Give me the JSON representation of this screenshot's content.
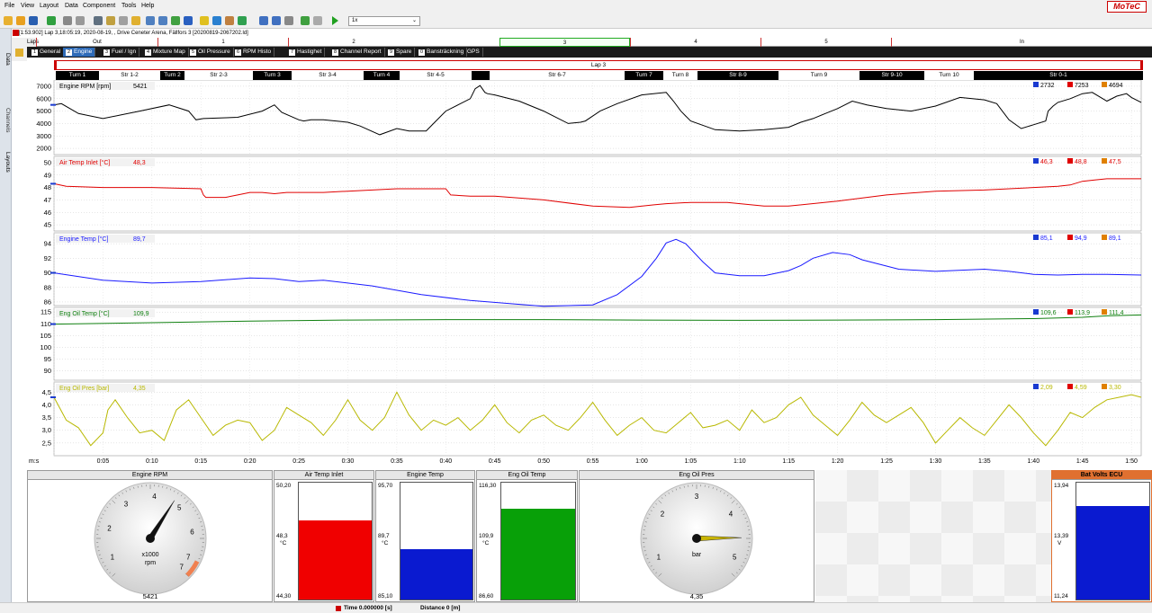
{
  "menu": [
    "File",
    "View",
    "Layout",
    "Data",
    "Component",
    "Tools",
    "Help"
  ],
  "brand": "MoTeC",
  "toolbar": {
    "zoom_value": "1x"
  },
  "dock_tabs": [
    "Data",
    "Channels",
    "Layouts"
  ],
  "file_info": "[1:53.902] Lap 3,18:05:19, 2020-08-19, , Drive Ceneter Arena, Fällfors 3 [20200819-2067202.ld]",
  "laps": {
    "label": "Laps",
    "items": [
      "Out",
      "1",
      "2",
      "3",
      "4",
      "5",
      "In"
    ]
  },
  "worksheet_tabs": [
    {
      "num": "1",
      "label": "General"
    },
    {
      "num": "2",
      "label": "Engine"
    },
    {
      "num": "3",
      "label": "Fuel / Ign"
    },
    {
      "num": "4",
      "label": "Mixture Map"
    },
    {
      "num": "5",
      "label": "Oil Pressure"
    },
    {
      "num": "6",
      "label": "RPM Histo"
    },
    {
      "num": "7",
      "label": "Hastighet"
    },
    {
      "num": "8",
      "label": "Channel Report"
    },
    {
      "num": "9",
      "label": "Spare"
    },
    {
      "num": "0",
      "label": "Bansträckning"
    },
    {
      "num": "",
      "label": "GPS"
    }
  ],
  "lap_band": "Lap 3",
  "sectors": [
    {
      "label": "Turn 1",
      "style": "b"
    },
    {
      "label": "Str 1-2",
      "style": "w"
    },
    {
      "label": "Turn 2",
      "style": "b"
    },
    {
      "label": "Str 2-3",
      "style": "w"
    },
    {
      "label": "Turn 3",
      "style": "b"
    },
    {
      "label": "Str 3-4",
      "style": "w"
    },
    {
      "label": "Turn 4",
      "style": "b"
    },
    {
      "label": "Str 4-5",
      "style": "w"
    },
    {
      "label": "",
      "style": "b"
    },
    {
      "label": "Str 6-7",
      "style": "w"
    },
    {
      "label": "Turn 7",
      "style": "b"
    },
    {
      "label": "Turn 8",
      "style": "w"
    },
    {
      "label": "Str 8-9",
      "style": "b"
    },
    {
      "label": "Turn 9",
      "style": "w"
    },
    {
      "label": "Str 9-10",
      "style": "b"
    },
    {
      "label": "Turn 10",
      "style": "w"
    },
    {
      "label": "Str 0-1",
      "style": "b"
    }
  ],
  "chart_data": [
    {
      "type": "line",
      "title": "Engine RPM [rpm]",
      "current": "5421",
      "color": "#000000",
      "ylim": [
        1500,
        7500
      ],
      "yticks": [
        "7000",
        "6000",
        "5000",
        "4000",
        "3000",
        "2000"
      ],
      "min": "2732",
      "max": "7253",
      "avg": "4694",
      "x": [
        0,
        3,
        10,
        20,
        35,
        47,
        55,
        58,
        61,
        75,
        85,
        90,
        93,
        100,
        102,
        105,
        110,
        120,
        125,
        133,
        140,
        145,
        152,
        155,
        160,
        165,
        170,
        172,
        174,
        176,
        177,
        180,
        190,
        200,
        210,
        215,
        217,
        220,
        223,
        230,
        240,
        250,
        253,
        256,
        258,
        260,
        270,
        280,
        290,
        300,
        305,
        310,
        315,
        320,
        326,
        332,
        340,
        350,
        360,
        370,
        375,
        380,
        385,
        390,
        395,
        400,
        405,
        406,
        408,
        410,
        415,
        420,
        424,
        430,
        434,
        438,
        440,
        444
      ],
      "y": [
        5500,
        5600,
        4800,
        4400,
        5000,
        5500,
        5000,
        4300,
        4400,
        4500,
        5000,
        5500,
        4900,
        4300,
        4200,
        4300,
        4300,
        4100,
        3800,
        3100,
        3600,
        3400,
        3400,
        4000,
        5000,
        5500,
        6000,
        6800,
        7050,
        6500,
        6400,
        6300,
        5800,
        5000,
        4000,
        4100,
        4200,
        4600,
        5000,
        5600,
        6300,
        6500,
        5800,
        5000,
        4600,
        4200,
        3500,
        3400,
        3500,
        3700,
        4100,
        4400,
        4800,
        5200,
        5800,
        5500,
        5200,
        5000,
        5400,
        6100,
        6000,
        5900,
        5600,
        4300,
        3600,
        3900,
        4200,
        5000,
        5400,
        5700,
        6000,
        6400,
        6500,
        5800,
        6200,
        6400,
        6100,
        5700
      ]
    },
    {
      "type": "line",
      "title": "Air Temp Inlet [°C]",
      "current": "48,3",
      "color": "#e00000",
      "ylim": [
        44.5,
        50.5
      ],
      "yticks": [
        "50",
        "49",
        "48",
        "47",
        "46",
        "45"
      ],
      "min": "46,3",
      "max": "48,8",
      "avg": "47,5",
      "x": [
        0,
        5,
        20,
        40,
        60,
        61,
        62,
        70,
        75,
        80,
        85,
        90,
        95,
        100,
        110,
        120,
        140,
        160,
        162,
        170,
        180,
        200,
        220,
        235,
        245,
        250,
        260,
        275,
        290,
        300,
        320,
        340,
        360,
        380,
        400,
        410,
        415,
        420,
        425,
        430,
        444
      ],
      "y": [
        48.3,
        48.1,
        48.0,
        48.0,
        47.9,
        47.4,
        47.2,
        47.2,
        47.4,
        47.6,
        47.6,
        47.5,
        47.6,
        47.6,
        47.6,
        47.7,
        47.9,
        47.9,
        47.4,
        47.3,
        47.3,
        47.0,
        46.5,
        46.4,
        46.6,
        46.7,
        46.8,
        46.8,
        46.5,
        46.5,
        46.9,
        47.4,
        47.7,
        47.8,
        48.0,
        48.1,
        48.2,
        48.5,
        48.6,
        48.7,
        48.7
      ]
    },
    {
      "type": "line",
      "title": "Engine Temp [°C]",
      "current": "89,7",
      "color": "#1a1aff",
      "ylim": [
        85.5,
        95.5
      ],
      "yticks": [
        "94",
        "92",
        "90",
        "88",
        "86"
      ],
      "min": "85,1",
      "max": "94,9",
      "avg": "89,1",
      "x": [
        0,
        20,
        40,
        60,
        80,
        90,
        100,
        110,
        130,
        150,
        170,
        200,
        220,
        230,
        240,
        246,
        250,
        254,
        258,
        265,
        270,
        280,
        290,
        300,
        305,
        310,
        318,
        325,
        330,
        345,
        360,
        380,
        390,
        400,
        410,
        420,
        430,
        444
      ],
      "y": [
        90.0,
        89.0,
        88.6,
        88.8,
        89.3,
        89.2,
        88.8,
        89.0,
        88.2,
        87.0,
        86.2,
        85.4,
        85.6,
        87.0,
        89.5,
        92.0,
        94.1,
        94.6,
        94.0,
        91.5,
        90.0,
        89.6,
        89.6,
        90.3,
        91.0,
        92.0,
        92.8,
        92.5,
        91.8,
        90.5,
        90.2,
        90.5,
        90.2,
        89.8,
        89.7,
        89.8,
        89.8,
        89.7
      ]
    },
    {
      "type": "line",
      "title": "Eng Oil Temp [°C]",
      "current": "109,9",
      "color": "#108010",
      "ylim": [
        86,
        117
      ],
      "yticks": [
        "115",
        "110",
        "105",
        "100",
        "95",
        "90"
      ],
      "min": "109,6",
      "max": "113,9",
      "avg": "111,4",
      "x": [
        0,
        40,
        80,
        120,
        160,
        200,
        240,
        280,
        320,
        360,
        400,
        420,
        430,
        444
      ],
      "y": [
        109.9,
        110.5,
        111.2,
        111.6,
        111.8,
        111.8,
        111.6,
        111.5,
        111.6,
        111.8,
        112.2,
        112.8,
        113.4,
        113.8
      ]
    },
    {
      "type": "line",
      "title": "Eng Oil Pres [bar]",
      "current": "4,35",
      "color": "#b8b800",
      "ylim": [
        2.0,
        4.9
      ],
      "yticks": [
        "4,5",
        "4,0",
        "3,5",
        "3,0",
        "2,5"
      ],
      "min": "2,09",
      "max": "4,59",
      "avg": "3,30",
      "x": [
        0,
        5,
        10,
        15,
        20,
        22,
        25,
        30,
        35,
        40,
        45,
        50,
        55,
        60,
        65,
        70,
        75,
        80,
        85,
        90,
        95,
        100,
        105,
        110,
        115,
        120,
        125,
        130,
        135,
        140,
        145,
        150,
        155,
        160,
        165,
        170,
        175,
        180,
        185,
        190,
        195,
        200,
        205,
        210,
        215,
        220,
        225,
        230,
        235,
        240,
        245,
        250,
        255,
        260,
        265,
        270,
        275,
        280,
        285,
        290,
        295,
        300,
        305,
        310,
        315,
        320,
        325,
        330,
        335,
        340,
        345,
        350,
        355,
        360,
        365,
        370,
        375,
        380,
        385,
        390,
        395,
        400,
        405,
        410,
        415,
        420,
        425,
        430,
        435,
        440,
        444
      ],
      "y": [
        4.3,
        3.4,
        3.1,
        2.4,
        2.9,
        3.8,
        4.2,
        3.5,
        2.9,
        3.0,
        2.6,
        3.8,
        4.2,
        3.5,
        2.8,
        3.2,
        3.4,
        3.3,
        2.6,
        3.0,
        3.9,
        3.6,
        3.3,
        2.8,
        3.4,
        4.2,
        3.4,
        3.0,
        3.5,
        4.5,
        3.6,
        3.0,
        3.4,
        3.2,
        3.5,
        3.0,
        3.4,
        4.0,
        3.3,
        2.9,
        3.4,
        3.6,
        3.2,
        3.0,
        3.5,
        4.1,
        3.4,
        2.8,
        3.2,
        3.5,
        3.0,
        2.9,
        3.3,
        3.7,
        3.1,
        3.2,
        3.4,
        3.0,
        3.8,
        3.3,
        3.5,
        4.0,
        4.3,
        3.6,
        3.2,
        2.8,
        3.4,
        4.1,
        3.6,
        3.3,
        3.6,
        3.9,
        3.3,
        2.5,
        3.0,
        3.5,
        3.1,
        2.8,
        3.4,
        4.0,
        3.5,
        2.9,
        2.4,
        3.0,
        3.7,
        3.5,
        3.9,
        4.2,
        4.3,
        4.4,
        4.3
      ]
    }
  ],
  "time_axis": {
    "label": "m:s",
    "ticks": [
      "0:05",
      "0:10",
      "0:15",
      "0:20",
      "0:25",
      "0:30",
      "0:35",
      "0:40",
      "0:45",
      "0:50",
      "0:55",
      "1:00",
      "1:05",
      "1:10",
      "1:15",
      "1:20",
      "1:25",
      "1:30",
      "1:35",
      "1:40",
      "1:45",
      "1:50"
    ]
  },
  "gauges": {
    "rpm": {
      "title": "Engine RPM",
      "labels": [
        "1",
        "2",
        "3",
        "4",
        "5",
        "6",
        "7",
        "7"
      ],
      "unit1": "x1000",
      "unit2": "rpm",
      "value": "5421",
      "fraction": 0.62
    },
    "oilpres": {
      "title": "Eng Oil Pres",
      "labels": [
        "1",
        "2",
        "3",
        "4",
        "5"
      ],
      "unit": "bar",
      "value": "4,35",
      "fraction": 0.83
    }
  },
  "bars": [
    {
      "title": "Air Temp Inlet",
      "max": "50,20",
      "mid": "48,3",
      "unit": "°C",
      "min": "44,30",
      "fraction": 0.68,
      "color": "#f00000"
    },
    {
      "title": "Engine Temp",
      "max": "95,70",
      "mid": "89,7",
      "unit": "°C",
      "min": "85,10",
      "fraction": 0.43,
      "color": "#0a1ad0"
    },
    {
      "title": "Eng Oil Temp",
      "max": "116,30",
      "mid": "109,9",
      "unit": "°C",
      "min": "86,60",
      "fraction": 0.78,
      "color": "#08a008"
    },
    {
      "title": "Bat Volts ECU",
      "max": "13,94",
      "mid": "13,39",
      "unit": "V",
      "min": "11,24",
      "fraction": 0.8,
      "color": "#0a1ad0"
    }
  ],
  "status": {
    "time": "Time  0.000000 [s]",
    "distance": "Distance  0 [m]"
  }
}
